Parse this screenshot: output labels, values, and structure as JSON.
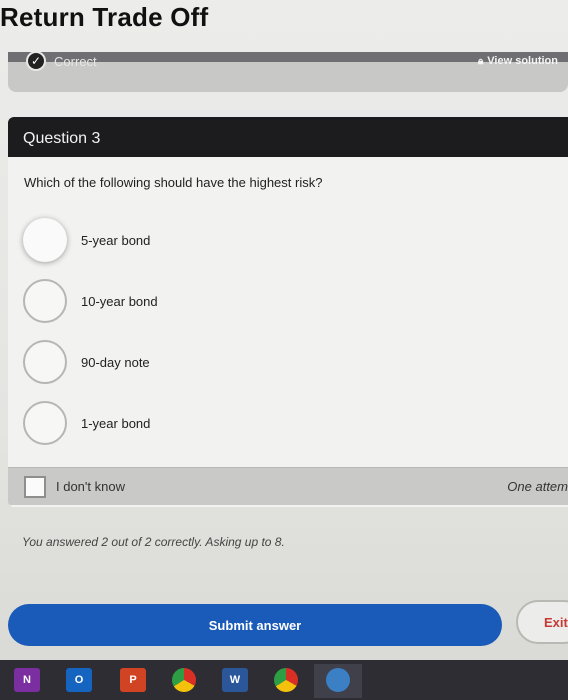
{
  "page": {
    "title": "Return Trade Off"
  },
  "status": {
    "label": "Correct",
    "view_solution": "View solution"
  },
  "question": {
    "header": "Question 3",
    "prompt": "Which of the following should have the highest risk?",
    "options": [
      {
        "label": "5-year bond",
        "selected": true
      },
      {
        "label": "10-year bond",
        "selected": false
      },
      {
        "label": "90-day note",
        "selected": false
      },
      {
        "label": "1-year bond",
        "selected": false
      }
    ],
    "dont_know": "I don't know",
    "attempts": "One attem"
  },
  "progress": "You answered 2 out of 2 correctly. Asking up to 8.",
  "actions": {
    "submit": "Submit answer",
    "exit": "Exit"
  },
  "taskbar": {
    "icons": [
      {
        "name": "onenote-icon",
        "glyph": "N",
        "color": "#7a2ea0"
      },
      {
        "name": "outlook-icon",
        "glyph": "O",
        "color": "#1565c0"
      },
      {
        "name": "powerpoint-icon",
        "glyph": "P",
        "color": "#d04423"
      },
      {
        "name": "chrome-icon",
        "glyph": "",
        "color": "#2e9e44"
      },
      {
        "name": "word-icon",
        "glyph": "W",
        "color": "#2b579a"
      },
      {
        "name": "chrome-icon-2",
        "glyph": "",
        "color": "#2e9e44"
      },
      {
        "name": "app-icon",
        "glyph": "",
        "color": "#3b7fc4"
      }
    ]
  },
  "colors": {
    "submit_bg": "#1a5ab8",
    "exit_text": "#c63a36",
    "header_bg": "#1c1c1e"
  }
}
